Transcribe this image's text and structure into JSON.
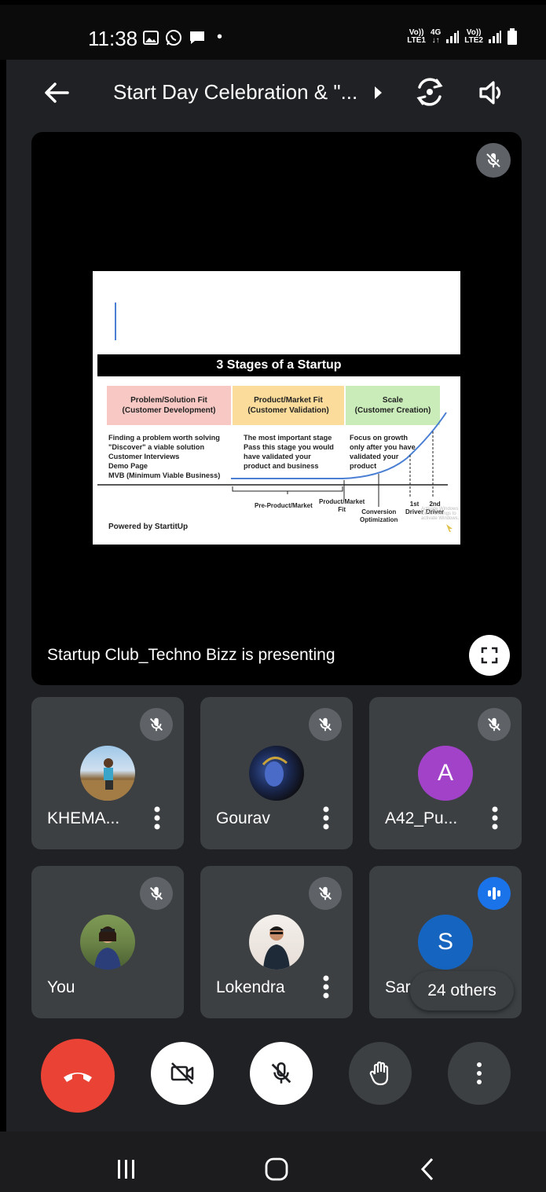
{
  "status_bar": {
    "time": "11:38",
    "dot": "•",
    "lte1_top": "Vo))",
    "lte1_bottom": "LTE1",
    "net_top": "4G",
    "net_bottom": "↓↑",
    "lte2_top": "Vo))",
    "lte2_bottom": "LTE2",
    "icons": [
      "gallery-icon",
      "whatsapp-icon",
      "message-icon",
      "signal-icon",
      "battery-icon"
    ]
  },
  "header": {
    "title": "Start Day Celebration & \"...",
    "icons": [
      "back-arrow-icon",
      "chevron-right-icon",
      "switch-camera-icon",
      "speaker-icon"
    ]
  },
  "presentation": {
    "presenting_text": "Startup Club_Techno Bizz is presenting",
    "slide": {
      "title": "3 Stages of a Startup",
      "stages": [
        {
          "heading": "Problem/Solution Fit",
          "sub": "(Customer Development)",
          "desc": "Finding a problem worth solving\n\"Discover\" a viable solution\nCustomer Interviews\nDemo Page\nMVB (Minimum Viable Business)"
        },
        {
          "heading": "Product/Market Fit",
          "sub": "(Customer Validation)",
          "desc": "The most important stage\nPass this stage you would\nhave validated your\nproduct and business"
        },
        {
          "heading": "Scale",
          "sub": "(Customer Creation)",
          "desc": "Focus on growth\nonly after you have\nvalidated your\nproduct"
        }
      ],
      "axis_labels": {
        "pre": "Pre-Product/Market",
        "fit": "Product/Market\nFit",
        "conversion": "Conversion\nOptimization",
        "driver1": "1st\nDriver",
        "driver2": "2nd\nDriver"
      },
      "powered_by": "Powered by StartitUp",
      "watermark": "Activate Windows\nGo to Settings to activate Windows."
    }
  },
  "participants": [
    {
      "name": "KHEMA...",
      "muted": true,
      "avatar": "photo"
    },
    {
      "name": "Gourav",
      "muted": true,
      "avatar": "photo"
    },
    {
      "name": "A42_Pu...",
      "muted": true,
      "avatar": "letter",
      "letter": "A",
      "color": "#a142c8"
    },
    {
      "name": "You",
      "muted": true,
      "avatar": "photo"
    },
    {
      "name": "Lokendra",
      "muted": true,
      "avatar": "photo"
    },
    {
      "name": "Sar",
      "muted": false,
      "speaking": true,
      "avatar": "letter",
      "letter": "S",
      "color": "#1565c0"
    }
  ],
  "others_chip": "24 others",
  "controls": [
    "end-call-icon",
    "camera-off-icon",
    "mic-off-icon",
    "raise-hand-icon",
    "more-options-icon"
  ],
  "colors": {
    "background": "#202124",
    "tile": "#3c4043",
    "end_call": "#ea4335",
    "speaking": "#1a73e8"
  }
}
